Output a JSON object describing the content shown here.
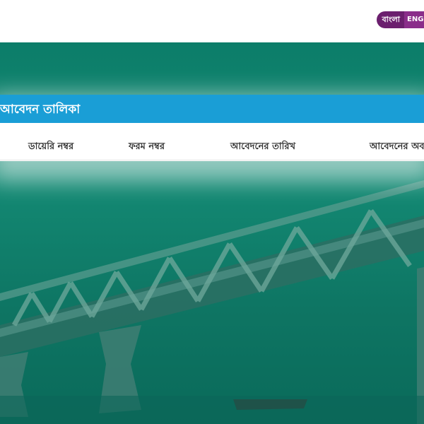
{
  "header": {
    "lang_bn": "বাংলা",
    "lang_en": "ENGLISH"
  },
  "panel": {
    "title": "আবেদন তালিকা",
    "columns": [
      "ডায়েরি নম্বর",
      "ফরম নম্বর",
      "আবেদনের তারিখ",
      "আবেদনের অবস্থা"
    ]
  },
  "colors": {
    "header_blue": "#1a9ed6",
    "hero_green": "#0f7a68",
    "lang_purple": "#6b1f6e"
  }
}
